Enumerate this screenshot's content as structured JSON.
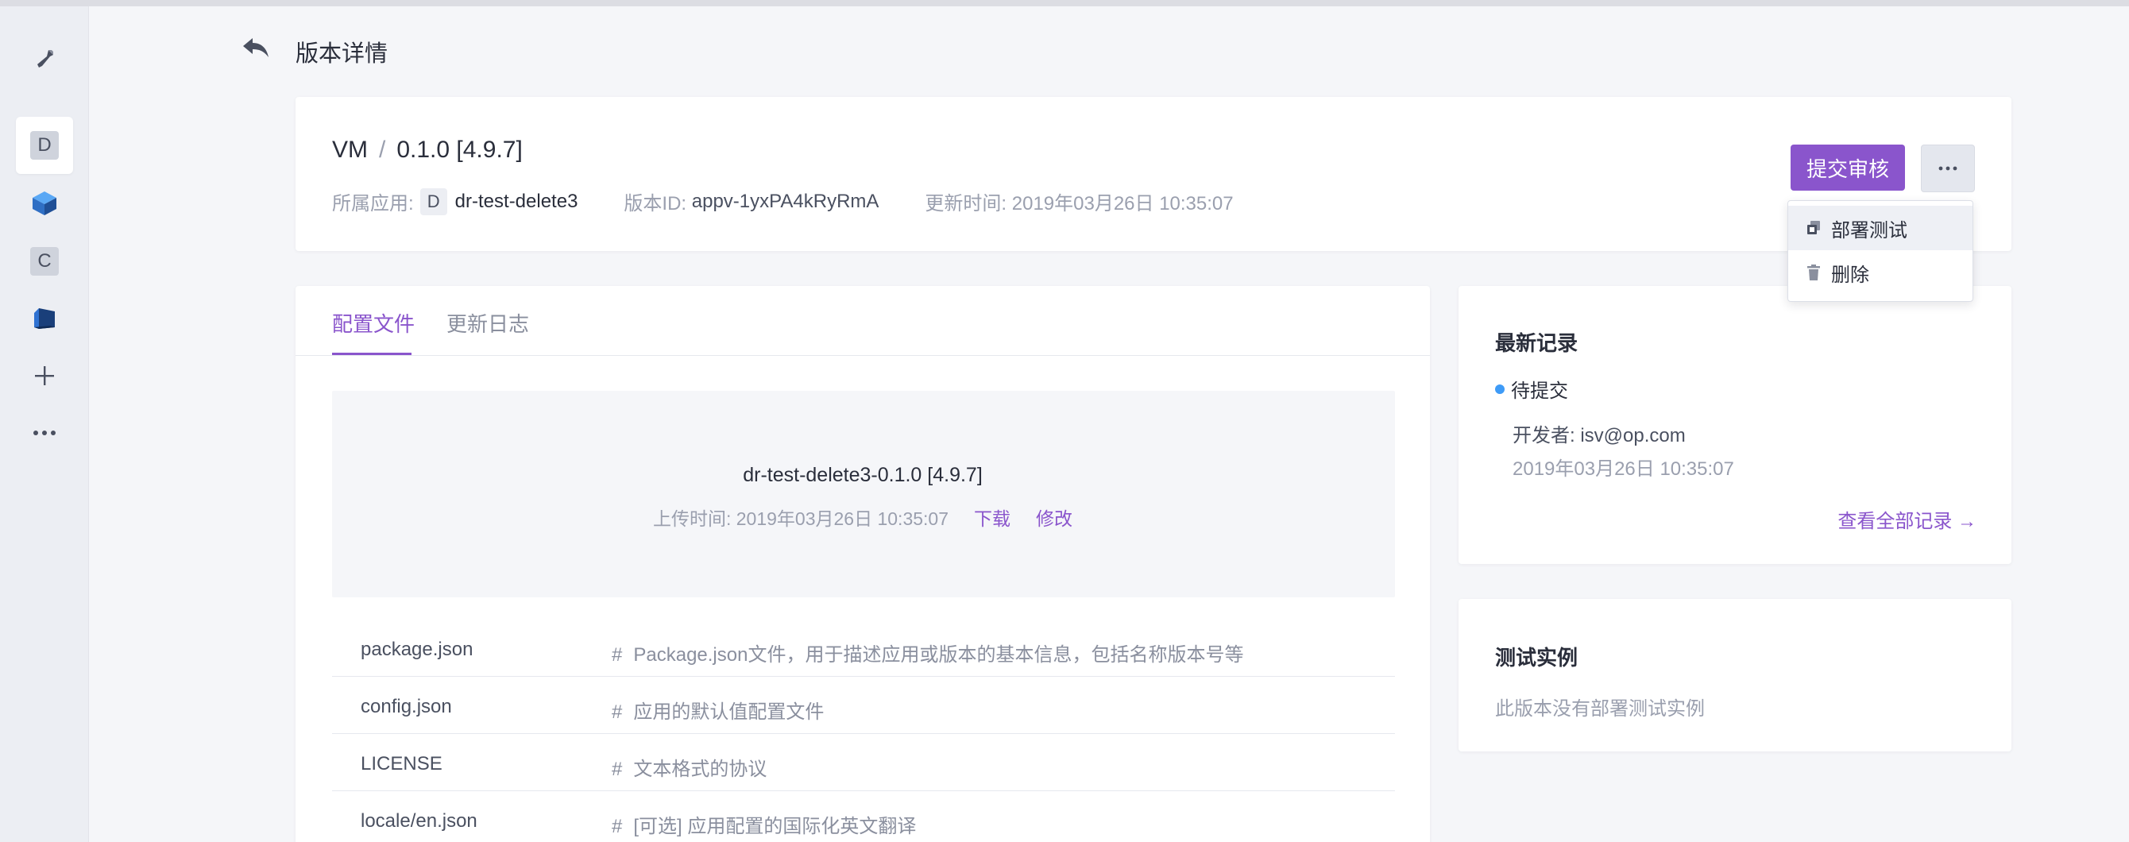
{
  "sidebar": {
    "items": [
      {
        "icon": "wrench-icon"
      },
      {
        "letter": "D"
      },
      {
        "icon": "blue-cube-icon"
      },
      {
        "letter": "C"
      },
      {
        "icon": "dark-cube-icon"
      },
      {
        "icon": "plus-icon"
      },
      {
        "icon": "more-icon"
      }
    ]
  },
  "header": {
    "back_icon": "back-arrow-icon",
    "title": "版本详情"
  },
  "version": {
    "app_short": "VM",
    "separator": "/",
    "version_label": "0.1.0 [4.9.7]",
    "app_label": "所属应用:",
    "app_badge": "D",
    "app_name": "dr-test-delete3",
    "version_id_label": "版本ID:",
    "version_id": "appv-1yxPA4kRyRmA",
    "updated_label": "更新时间:",
    "updated_time": "2019年03月26日 10:35:07",
    "submit_label": "提交审核",
    "more_label": "···"
  },
  "dropdown": {
    "items": [
      {
        "label": "部署测试",
        "icon": "deploy-icon"
      },
      {
        "label": "删除",
        "icon": "trash-icon"
      }
    ]
  },
  "tabs": [
    {
      "label": "配置文件",
      "active": true
    },
    {
      "label": "更新日志",
      "active": false
    }
  ],
  "package": {
    "name": "dr-test-delete3-0.1.0 [4.9.7]",
    "upload_label": "上传时间: 2019年03月26日 10:35:07",
    "download_label": "下载",
    "edit_label": "修改"
  },
  "files": [
    {
      "name": "package.json",
      "hash": "#",
      "desc": "Package.json文件，用于描述应用或版本的基本信息，包括名称版本号等"
    },
    {
      "name": "config.json",
      "hash": "#",
      "desc": "应用的默认值配置文件"
    },
    {
      "name": "LICENSE",
      "hash": "#",
      "desc": "文本格式的协议"
    },
    {
      "name": "locale/en.json",
      "hash": "#",
      "desc": "[可选] 应用配置的国际化英文翻译"
    }
  ],
  "latest_record": {
    "title": "最新记录",
    "status": "待提交",
    "status_color": "#3e9bf7",
    "developer": "开发者: isv@op.com",
    "time": "2019年03月26日 10:35:07",
    "view_all": "查看全部记录 →"
  },
  "test_instances": {
    "title": "测试实例",
    "empty": "此版本没有部署测试实例"
  },
  "colors": {
    "accent": "#8a55cc",
    "background": "#f5f6f9"
  }
}
